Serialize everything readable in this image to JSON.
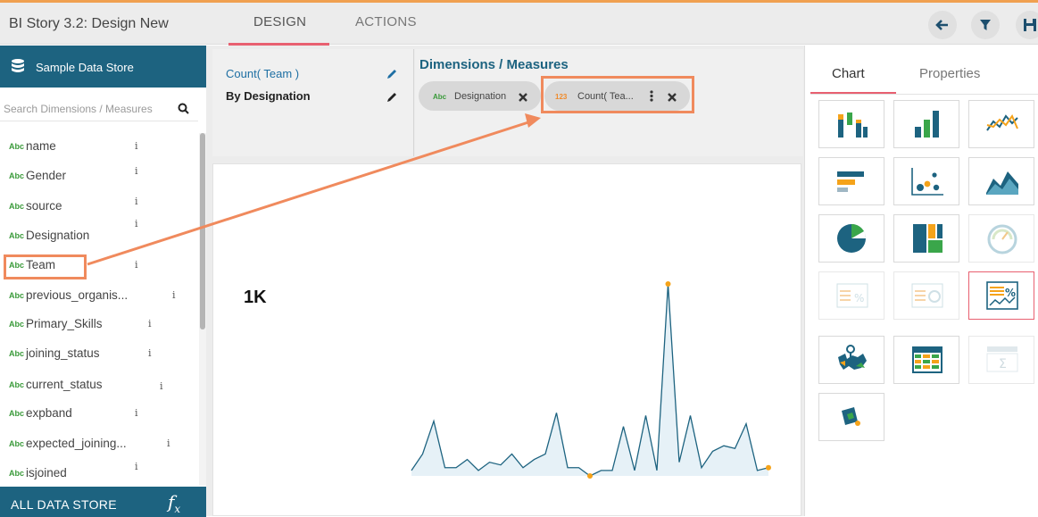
{
  "topbar": {
    "title": "BI Story 3.2: Design New",
    "tabs": [
      {
        "label": "DESIGN",
        "active": true
      },
      {
        "label": "ACTIONS",
        "active": false
      }
    ],
    "buttons": [
      "back-icon",
      "filter-icon",
      "save-icon"
    ]
  },
  "left_panel": {
    "store_name": "Sample Data Store",
    "search_placeholder": "Search Dimensions / Measures",
    "fields": [
      {
        "type": "Abc",
        "name": "name"
      },
      {
        "type": "Abc",
        "name": "Gender"
      },
      {
        "type": "Abc",
        "name": "source"
      },
      {
        "type": "Abc",
        "name": "Designation"
      },
      {
        "type": "Abc",
        "name": "Team"
      },
      {
        "type": "Abc",
        "name": "previous_organis..."
      },
      {
        "type": "Abc",
        "name": "Primary_Skills"
      },
      {
        "type": "Abc",
        "name": "joining_status"
      },
      {
        "type": "Abc",
        "name": "current_status"
      },
      {
        "type": "Abc",
        "name": "expband"
      },
      {
        "type": "Abc",
        "name": "expected_joining..."
      },
      {
        "type": "Abc",
        "name": "isjoined"
      }
    ],
    "info_glyph": "i",
    "footer": "ALL DATA STORE",
    "fx": "f",
    "fx_sub": "x"
  },
  "config": {
    "measure": "Count( Team )",
    "dimension": "By Designation",
    "dm_title": "Dimensions / Measures",
    "chips": [
      {
        "type": "Abc",
        "label": "Designation",
        "color": "#3a9a3a"
      },
      {
        "type": "123",
        "label": "Count( Tea...",
        "color": "#f08a2a"
      }
    ]
  },
  "chart": {
    "kpi_value": "1K",
    "accent": "#1d6380",
    "marker_color": "#f5a31a"
  },
  "chart_data": {
    "type": "line",
    "title": "",
    "xlabel": "",
    "ylabel": "",
    "values": [
      2,
      8,
      20,
      3,
      3,
      6,
      2,
      5,
      4,
      8,
      3,
      6,
      8,
      23,
      3,
      3,
      0,
      2,
      2,
      18,
      2,
      22,
      2,
      70,
      5,
      22,
      3,
      9,
      11,
      10,
      19,
      2,
      3
    ]
  },
  "right_panel": {
    "tabs": [
      {
        "label": "Chart",
        "active": true
      },
      {
        "label": "Properties",
        "active": false
      }
    ]
  }
}
